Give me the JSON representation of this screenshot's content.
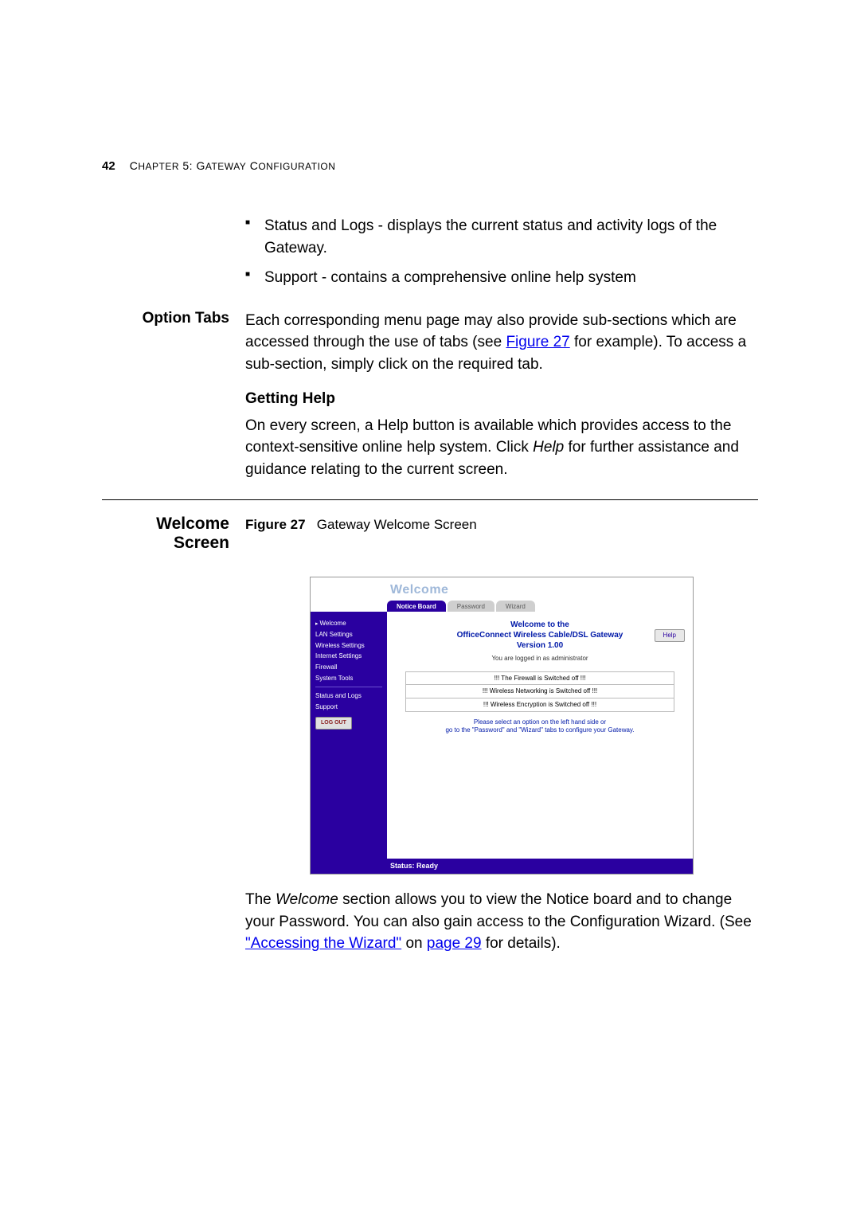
{
  "page_number": "42",
  "chapter_prefix": "C",
  "chapter_word": "HAPTER",
  "chapter_num": "5: G",
  "chapter_rest": "ATEWAY",
  "chapter_conf_c": "C",
  "chapter_conf_rest": "ONFIGURATION",
  "bullets": {
    "b1_a": "Status and Logs - displays the current status and activity logs of the Gateway.",
    "b2_a": "Support - contains a comprehensive online help system"
  },
  "option_tabs": {
    "heading": "Option Tabs",
    "para_a": "Each corresponding menu page may also provide sub-sections which are accessed through the use of tabs (see ",
    "para_link": "Figure 27",
    "para_b": " for example). To access a sub-section, simply click on the required tab."
  },
  "getting_help": {
    "heading": "Getting Help",
    "para_a": "On every screen, a Help button is available which provides access to the context-sensitive online help system. Click ",
    "para_italic": "Help",
    "para_b": " for further assistance and guidance relating to the current screen."
  },
  "welcome_section": {
    "heading": "Welcome Screen",
    "figure_label": "Figure 27",
    "figure_caption": "Gateway Welcome Screen",
    "para_a": "The ",
    "para_italic": "Welcome",
    "para_b": " section allows you to view the Notice board and to change your Password. You can also gain access to the Configuration Wizard. (See ",
    "para_link1": "\"Accessing the Wizard\"",
    "para_c": " on ",
    "para_link2": "page 29",
    "para_d": " for details)."
  },
  "shot": {
    "title": "Welcome",
    "tab_active": "Notice Board",
    "tab_pw": "Password",
    "tab_wiz": "Wizard",
    "nav": {
      "welcome": "Welcome",
      "lan": "LAN Settings",
      "wireless": "Wireless Settings",
      "internet": "Internet Settings",
      "firewall": "Firewall",
      "tools": "System Tools",
      "status": "Status and Logs",
      "support": "Support",
      "logout": "LOG OUT"
    },
    "panel": {
      "line1": "Welcome to the",
      "line2": "OfficeConnect Wireless Cable/DSL Gateway",
      "line3": "Version 1.00",
      "sub": "You are logged in as administrator",
      "msg1": "!!! The Firewall is Switched off !!!",
      "msg2": "!!! Wireless Networking is Switched off !!!",
      "msg3": "!!! Wireless Encryption is Switched off !!!",
      "hint1": "Please select an option on the left hand side or",
      "hint2": "go to the \"Password\" and \"Wizard\" tabs to configure your Gateway.",
      "help": "Help"
    },
    "status": "Status: Ready"
  }
}
